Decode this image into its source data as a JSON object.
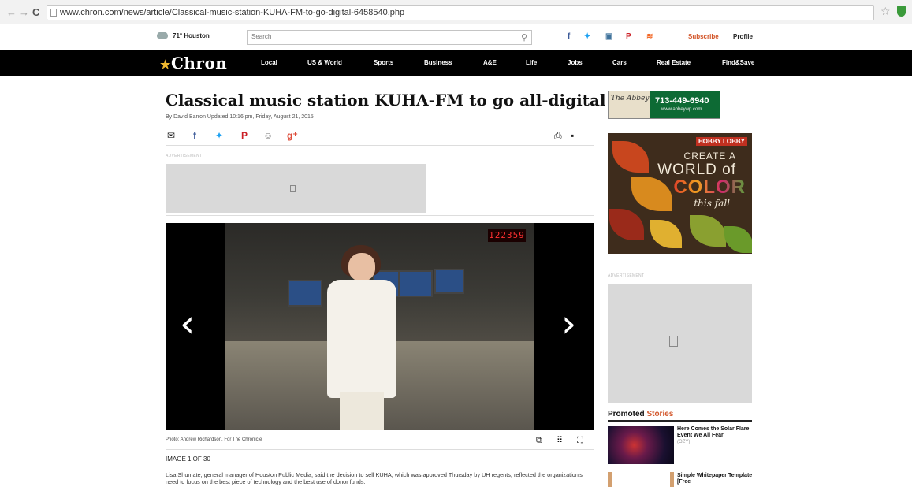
{
  "browser": {
    "url": "www.chron.com/news/article/Classical-music-station-KUHA-FM-to-go-digital-6458540.php"
  },
  "utility": {
    "weather": "71° Houston",
    "search_placeholder": "Search",
    "subscribe": "Subscribe",
    "profile": "Profile"
  },
  "nav": {
    "logo": "Chron",
    "items": [
      "Local",
      "US & World",
      "Sports",
      "Business",
      "A&E",
      "Life",
      "Jobs",
      "Cars",
      "Real Estate",
      "Find&Save"
    ]
  },
  "article": {
    "headline": "Classical music station KUHA-FM to go all-digital",
    "byline": "By David Barron  Updated 10:16 pm, Friday, August 21, 2015",
    "ad_label": "ADVERTISEMENT",
    "photo_credit": "Photo: Andrew Richardson, For The Chronicle",
    "image_counter": "IMAGE 1 OF 30",
    "led_counter": "122359",
    "body": "Lisa Shumate, general manager of Houston Public Media, said the decision to sell KUHA, which was approved Thursday by UH regents, reflected the organization's need to focus on the best piece of technology and the best use of donor funds."
  },
  "sidebar": {
    "abbey_logo": "The Abbey",
    "abbey_phone": "713-449-6940",
    "abbey_url": "www.abbeywp.com",
    "hobby_brand": "HOBBY LOBBY",
    "hobby_line1": "CREATE A",
    "hobby_line2": "WORLD of",
    "hobby_line3": "COLOR",
    "hobby_line4": "this fall",
    "ad_label": "ADVERTISEMENT",
    "promoted_label": "Promoted",
    "promoted_accent": "Stories",
    "promo1_title": "Here Comes the Solar Flare Event We All Fear",
    "promo1_source": "(OZY)",
    "promo2_title": "Simple Whitepaper Template [Free"
  },
  "colors": {
    "brand_orange": "#d3572b",
    "nav_bg": "#000000",
    "abbey_green": "#0d6a34"
  }
}
